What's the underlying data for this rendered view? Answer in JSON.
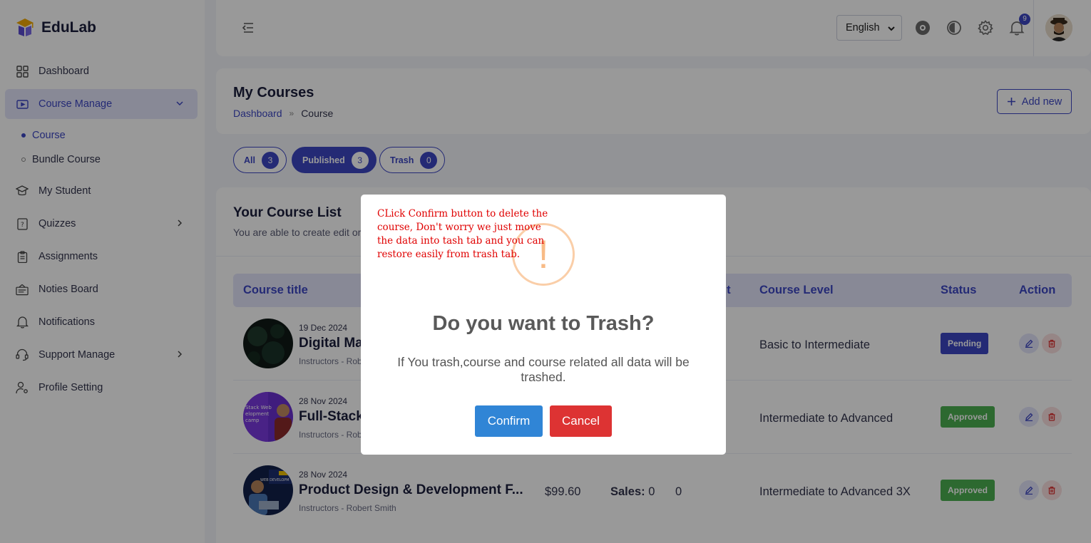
{
  "app": {
    "name": "EduLab"
  },
  "sidebar": {
    "items": [
      {
        "label": "Dashboard",
        "icon": "dashboard-grid-icon"
      },
      {
        "label": "Course Manage",
        "icon": "video-course-icon"
      },
      {
        "label": "My Student",
        "icon": "graduation-cap-icon"
      },
      {
        "label": "Quizzes",
        "icon": "quiz-icon"
      },
      {
        "label": "Assignments",
        "icon": "clipboard-icon"
      },
      {
        "label": "Noties Board",
        "icon": "notice-board-icon"
      },
      {
        "label": "Notifications",
        "icon": "bell-icon"
      },
      {
        "label": "Support Manage",
        "icon": "headset-icon"
      },
      {
        "label": "Profile Setting",
        "icon": "user-gear-icon"
      }
    ],
    "sub_items": [
      {
        "label": "Course",
        "active": true
      },
      {
        "label": "Bundle Course",
        "active": false
      }
    ]
  },
  "topbar": {
    "language": "English",
    "notification_count": "9"
  },
  "header": {
    "title": "My Courses",
    "breadcrumb": {
      "home": "Dashboard",
      "separator": "»",
      "current": "Course"
    },
    "add_button": "Add new"
  },
  "tabs": [
    {
      "label": "All",
      "count": "3"
    },
    {
      "label": "Published",
      "count": "3"
    },
    {
      "label": "Trash",
      "count": "0"
    }
  ],
  "list": {
    "title": "Your Course List",
    "subtitle": "You are able to create edit or",
    "columns": [
      "Course title",
      "nt",
      "Course Level",
      "Status",
      "Action"
    ],
    "rows": [
      {
        "date": "19 Dec 2024",
        "title": "Digital Ma",
        "instructor": "Instructors - Rob",
        "price": "",
        "sales_label": "",
        "sales": "",
        "students": "",
        "level": "Basic to Intermediate",
        "status": "Pending",
        "status_color": "#3d47c4"
      },
      {
        "date": "28 Nov 2024",
        "title": "Full-Stack",
        "instructor": "Instructors - Rob",
        "price": "",
        "sales_label": "",
        "sales": "",
        "students": "",
        "level": "Intermediate to Advanced",
        "status": "Approved",
        "status_color": "#4caf50"
      },
      {
        "date": "28 Nov 2024",
        "title": "Product Design & Development F...",
        "instructor": "Instructors - Robert Smith",
        "price": "$99.60",
        "sales_label": "Sales:",
        "sales": "0",
        "students": "0",
        "level": "Intermediate to Advanced 3X",
        "status": "Approved",
        "status_color": "#4caf50"
      }
    ]
  },
  "modal": {
    "annotation": "CLick Confirm button to delete the course, Don't worry we just move the data into tash tab and you can restore easily from trash tab.",
    "icon": "!",
    "title": "Do you want to Trash?",
    "text": "If You trash,course and course related all data will be trashed.",
    "confirm": "Confirm",
    "cancel": "Cancel"
  },
  "colors": {
    "accent": "#3d47c4",
    "confirm": "#3085d6",
    "cancel": "#dd3333",
    "warning": "#f8bb86"
  }
}
